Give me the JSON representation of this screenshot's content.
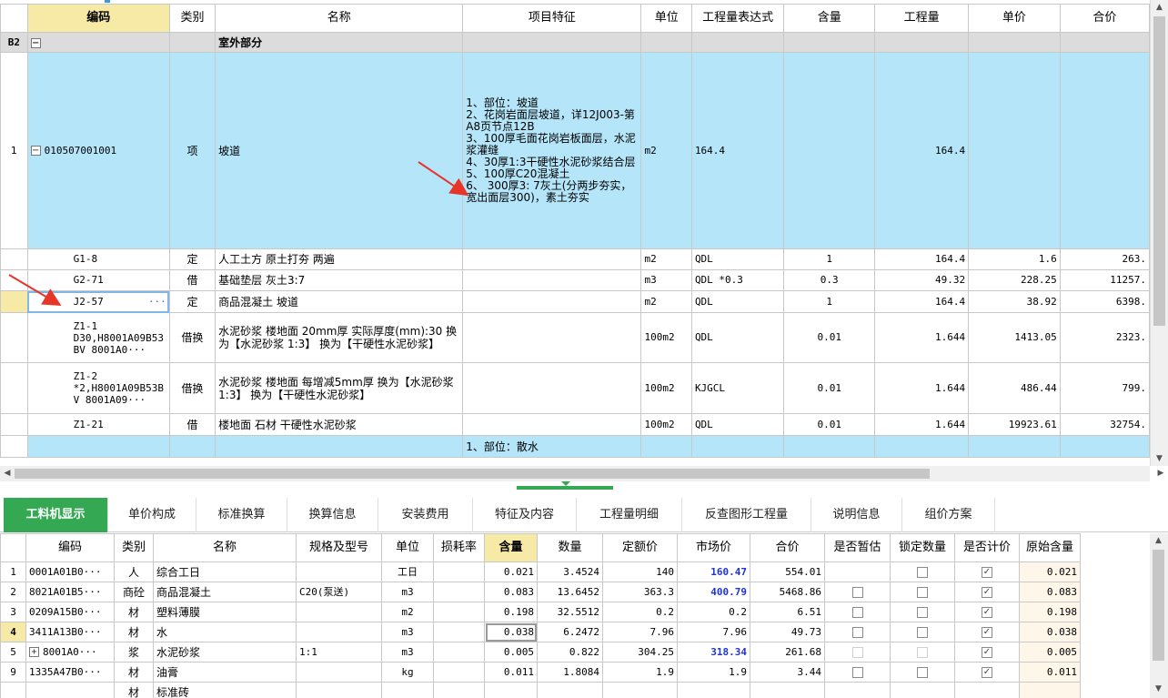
{
  "top_grid": {
    "headers": {
      "code": "编码",
      "type": "类别",
      "name": "名称",
      "feature": "项目特征",
      "unit": "单位",
      "expr": "工程量表达式",
      "content": "含量",
      "qty": "工程量",
      "price": "单价",
      "total": "合价"
    },
    "section": {
      "num": "B2",
      "toggle": "−",
      "name": "室外部分"
    },
    "bill": {
      "num": "1",
      "toggle": "−",
      "code": "010507001001",
      "type": "项",
      "name": "坡道",
      "feature": "1、部位：坡道\n2、花岗岩面层坡道，详12J003-第A8页节点12B\n3、100厚毛面花岗岩板面层，水泥浆灌缝\n4、30厚1:3干硬性水泥砂浆结合层\n5、100厚C20混凝土\n6、 300厚3: 7灰土(分两步夯实，宽出面层300)，素土夯实",
      "unit": "m2",
      "expr": "164.4",
      "qty": "164.4"
    },
    "rows": [
      {
        "code": "G1-8",
        "type": "定",
        "name": "人工土方 原土打夯 两遍",
        "unit": "m2",
        "expr": "QDL",
        "content": "1",
        "qty": "164.4",
        "price": "1.6",
        "total": "263."
      },
      {
        "code": "G2-71",
        "type": "借",
        "name": "基础垫层 灰土3:7",
        "unit": "m3",
        "expr": "QDL *0.3",
        "content": "0.3",
        "qty": "49.32",
        "price": "228.25",
        "total": "11257."
      },
      {
        "code": "J2-57",
        "type": "定",
        "name": "商品混凝土 坡道",
        "unit": "m2",
        "expr": "QDL",
        "content": "1",
        "qty": "164.4",
        "price": "38.92",
        "total": "6398.",
        "ellipsis": "···"
      },
      {
        "code": "Z1-1\nD30,H8001A09B53BV 8001A0···",
        "type": "借换",
        "name": "水泥砂浆 楼地面 20mm厚 实际厚度(mm):30 换为【水泥砂浆 1:3】 换为【干硬性水泥砂浆】",
        "unit": "100m2",
        "expr": "QDL",
        "content": "0.01",
        "qty": "1.644",
        "price": "1413.05",
        "total": "2323."
      },
      {
        "code": "Z1-2\n*2,H8001A09B53BV 8001A09···",
        "type": "借换",
        "name": "水泥砂浆 楼地面 每增减5mm厚 换为【水泥砂浆 1:3】 换为【干硬性水泥砂浆】",
        "unit": "100m2",
        "expr": "KJGCL",
        "content": "0.01",
        "qty": "1.644",
        "price": "486.44",
        "total": "799."
      },
      {
        "code": "Z1-21",
        "type": "借",
        "name": "楼地面 石材 干硬性水泥砂浆",
        "unit": "100m2",
        "expr": "QDL",
        "content": "0.01",
        "qty": "1.644",
        "price": "19923.61",
        "total": "32754."
      }
    ],
    "next_feature": "1、部位：散水"
  },
  "tabs": [
    "工料机显示",
    "单价构成",
    "标准换算",
    "换算信息",
    "安装费用",
    "特征及内容",
    "工程量明细",
    "反查图形工程量",
    "说明信息",
    "组价方案"
  ],
  "bottom_grid": {
    "headers": {
      "code": "编码",
      "type": "类别",
      "name": "名称",
      "spec": "规格及型号",
      "unit": "单位",
      "loss": "损耗率",
      "content": "含量",
      "amount": "数量",
      "quota_price": "定额价",
      "market_price": "市场价",
      "total": "合价",
      "temp": "是否暂估",
      "lock": "锁定数量",
      "priced": "是否计价",
      "orig": "原始含量"
    },
    "rows": [
      {
        "num": "1",
        "code": "0001A01B0···",
        "type": "人",
        "name": "综合工日",
        "spec": "",
        "unit": "工日",
        "content": "0.021",
        "amount": "3.4524",
        "quota_price": "140",
        "market_price": "160.47",
        "total": "554.01",
        "orig": "0.021"
      },
      {
        "num": "2",
        "code": "8021A01B5···",
        "type": "商砼",
        "name": "商品混凝土",
        "spec": "C20(泵送)",
        "unit": "m3",
        "content": "0.083",
        "amount": "13.6452",
        "quota_price": "363.3",
        "market_price": "400.79",
        "total": "5468.86",
        "orig": "0.083"
      },
      {
        "num": "3",
        "code": "0209A15B0···",
        "type": "材",
        "name": "塑料薄膜",
        "spec": "",
        "unit": "m2",
        "content": "0.198",
        "amount": "32.5512",
        "quota_price": "0.2",
        "market_price": "0.2",
        "total": "6.51",
        "orig": "0.198"
      },
      {
        "num": "4",
        "code": "3411A13B0···",
        "type": "材",
        "name": "水",
        "spec": "",
        "unit": "m3",
        "content": "0.038",
        "amount": "6.2472",
        "quota_price": "7.96",
        "market_price": "7.96",
        "total": "49.73",
        "orig": "0.038"
      },
      {
        "num": "5",
        "code": "8001A0···",
        "type": "浆",
        "name": "水泥砂浆",
        "spec": "1:1",
        "unit": "m3",
        "content": "0.005",
        "amount": "0.822",
        "quota_price": "304.25",
        "market_price": "318.34",
        "total": "261.68",
        "orig": "0.005",
        "expand": "+"
      },
      {
        "num": "9",
        "code": "1335A47B0···",
        "type": "材",
        "name": "油膏",
        "spec": "",
        "unit": "kg",
        "content": "0.011",
        "amount": "1.8084",
        "quota_price": "1.9",
        "market_price": "1.9",
        "total": "3.44",
        "orig": "0.011"
      }
    ],
    "partial_row": {
      "type": "材",
      "name": "标准砖"
    }
  },
  "colors": {
    "accent": "#34a853",
    "bill_bg": "#b5e5f9",
    "sorted_header": "#f7e9a6",
    "market_price_text": "#1f33d6",
    "arrow": "#e8352a"
  }
}
